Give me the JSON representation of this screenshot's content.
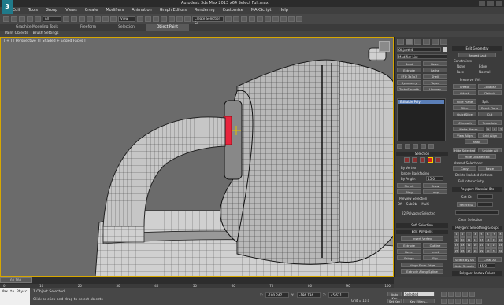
{
  "window": {
    "title": "Autodesk 3ds Max 2013 x64   Select Full.max",
    "logo": "3"
  },
  "menu": [
    "Edit",
    "Tools",
    "Group",
    "Views",
    "Create",
    "Modifiers",
    "Animation",
    "Graph Editors",
    "Rendering",
    "Customize",
    "MAXScript",
    "Help"
  ],
  "toolbar": {
    "selection_filter": "All",
    "view_dropdown": "View",
    "selection_set": "Create Selection Se"
  },
  "ribbon": {
    "tabs": [
      "Graphite Modeling Tools",
      "Freeform",
      "Selection",
      "Object Paint"
    ],
    "active_tab": "Object Paint",
    "sub_tabs": [
      "Paint Objects",
      "Brush Settings"
    ]
  },
  "viewport": {
    "label": "[ + ] [ Perspective ] [ Shaded + Edged Faces ]"
  },
  "command_panel": {
    "object_name": "Object04",
    "modifier_list": "Modifier List",
    "buttons": [
      [
        "Bend",
        "Bevel"
      ],
      [
        "Extrude",
        "Lathe"
      ],
      [
        "FFD 3x3x3",
        "Shell"
      ],
      [
        "Symmetry",
        "Taper"
      ],
      [
        "TurboSmooth",
        "Unwrap"
      ]
    ],
    "stack_item": "Editable Poly",
    "selection_header": "Selection",
    "checks": [
      "By Vertex",
      "Ignore Backfacing",
      "By Angle:"
    ],
    "by_angle_value": "45.0",
    "shrink": "Shrink",
    "grow": "Grow",
    "ring": "Ring",
    "loop": "Loop",
    "preview_selection": "Preview Selection",
    "preview_opts": [
      "Off",
      "SubObj",
      "Multi"
    ],
    "selected_count": "22 Polygons Selected",
    "soft_selection": "Soft Selection",
    "edit_polygons": "Edit Polygons",
    "insert_vertex": "Insert Vertex",
    "poly_buttons": [
      [
        "Extrude",
        "Outline"
      ],
      [
        "Bevel",
        "Inset"
      ],
      [
        "Bridge",
        "Flip"
      ]
    ],
    "hinge": "Hinge From Edge",
    "extrude_spline": "Extrude Along Spline",
    "edit_tri": "Edit Triangulation",
    "retri": [
      "Retriangulate",
      "Turn"
    ]
  },
  "rollout": {
    "edit_geometry": "Edit Geometry",
    "repeat_last": "Repeat Last",
    "constraints": "Constraints",
    "constraint_opts": [
      "None",
      "Edge",
      "Face",
      "Normal"
    ],
    "preserve_uvs": "Preserve UVs",
    "create_collapse": [
      "Create",
      "Collapse"
    ],
    "attach_detach": [
      "Attach",
      "Detach"
    ],
    "slice_plane": "Slice Plane",
    "split": "Split",
    "slice_reset": [
      "Slice",
      "Reset Plane"
    ],
    "quickslice_cut": [
      "QuickSlice",
      "Cut"
    ],
    "msmooth": "MSmooth",
    "tessellate": "Tessellate",
    "make_planar": "Make Planar",
    "xyz": [
      "X",
      "Y",
      "Z"
    ],
    "align": [
      "View Align",
      "Grid Align"
    ],
    "relax": "Relax",
    "hide": [
      "Hide Selected",
      "Unhide All"
    ],
    "hide_unselected": "Hide Unselected",
    "named_selections": "Named Selections:",
    "copy_paste": [
      "Copy",
      "Paste"
    ],
    "delete_isolated": "Delete Isolated Vertices",
    "full_interactivity": "Full Interactivity",
    "material_ids": "Polygon: Material IDs",
    "set_id": "Set ID:",
    "select_id": "Select ID",
    "clear_selection": "Clear Selection",
    "smoothing_groups": "Polygon: Smoothing Groups",
    "smooth_nums": [
      "1",
      "2",
      "3",
      "4",
      "5",
      "6",
      "7",
      "8",
      "9",
      "10",
      "11",
      "12",
      "13",
      "14",
      "15",
      "16",
      "17",
      "18",
      "19",
      "20",
      "21",
      "22",
      "23",
      "24",
      "25",
      "26",
      "27",
      "28",
      "29",
      "30",
      "31",
      "32"
    ],
    "select_by_sg": "Select By SG",
    "clear_all": "Clear All",
    "auto_smooth": "Auto Smooth",
    "auto_smooth_value": "45.0",
    "vertex_colors": "Polygon: Vertex Colors",
    "color": "Color"
  },
  "timeline": {
    "frame": "0 / 100",
    "ticks": [
      "0",
      "10",
      "20",
      "30",
      "40",
      "50",
      "60",
      "70",
      "80",
      "90",
      "100"
    ]
  },
  "status": {
    "maxscript": "Max to Physc",
    "objects_selected": "1 Object Selected",
    "prompt": "Click or click-and-drag to select objects",
    "x_label": "X:",
    "x": "-180.247",
    "y_label": "Y:",
    "y": "-186.136",
    "z_label": "Z:",
    "z": "45.631",
    "grid": "Grid = 10.0",
    "autokey": "Auto Key",
    "setkey": "Set Key",
    "key_mode": "Selected",
    "key_filters": "Key Filters..."
  }
}
